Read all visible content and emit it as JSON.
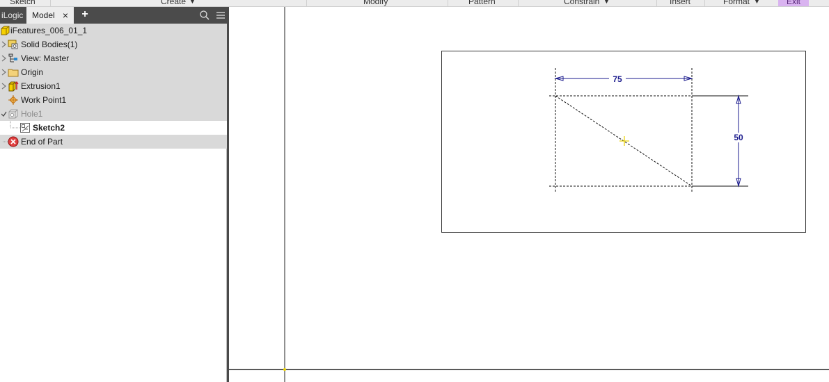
{
  "ribbon": {
    "items": [
      "Sketch",
      "Create",
      "Modify",
      "Pattern",
      "Constrain",
      "Insert",
      "Format",
      "Exit"
    ]
  },
  "browser": {
    "tabs": [
      "iLogic",
      "Model"
    ],
    "active_tab": "Model",
    "close_glyph": "×",
    "add_glyph": "+",
    "tree": [
      {
        "label": "iFeatures_006_01_1",
        "icon": "part-icon",
        "state": "normal"
      },
      {
        "label": "Solid Bodies(1)",
        "icon": "solid-bodies-icon",
        "state": "normal"
      },
      {
        "label": "View: Master",
        "icon": "view-icon",
        "state": "normal"
      },
      {
        "label": "Origin",
        "icon": "folder-icon",
        "state": "normal"
      },
      {
        "label": "Extrusion1",
        "icon": "extrusion-icon",
        "state": "normal"
      },
      {
        "label": "Work Point1",
        "icon": "work-point-icon",
        "state": "normal"
      },
      {
        "label": "Hole1",
        "icon": "hole-icon",
        "state": "dimmed"
      },
      {
        "label": "Sketch2",
        "icon": "sketch-icon",
        "state": "active"
      },
      {
        "label": "End of Part",
        "icon": "end-of-part-icon",
        "state": "normal"
      }
    ]
  },
  "sketch": {
    "dim_horizontal": "75",
    "dim_vertical": "50"
  },
  "colors": {
    "tab_bar": "#4b4b4b",
    "tree_bg": "#d9d9d9",
    "dimension": "#1a1a8c",
    "exit_button": "#d9b3f0"
  }
}
